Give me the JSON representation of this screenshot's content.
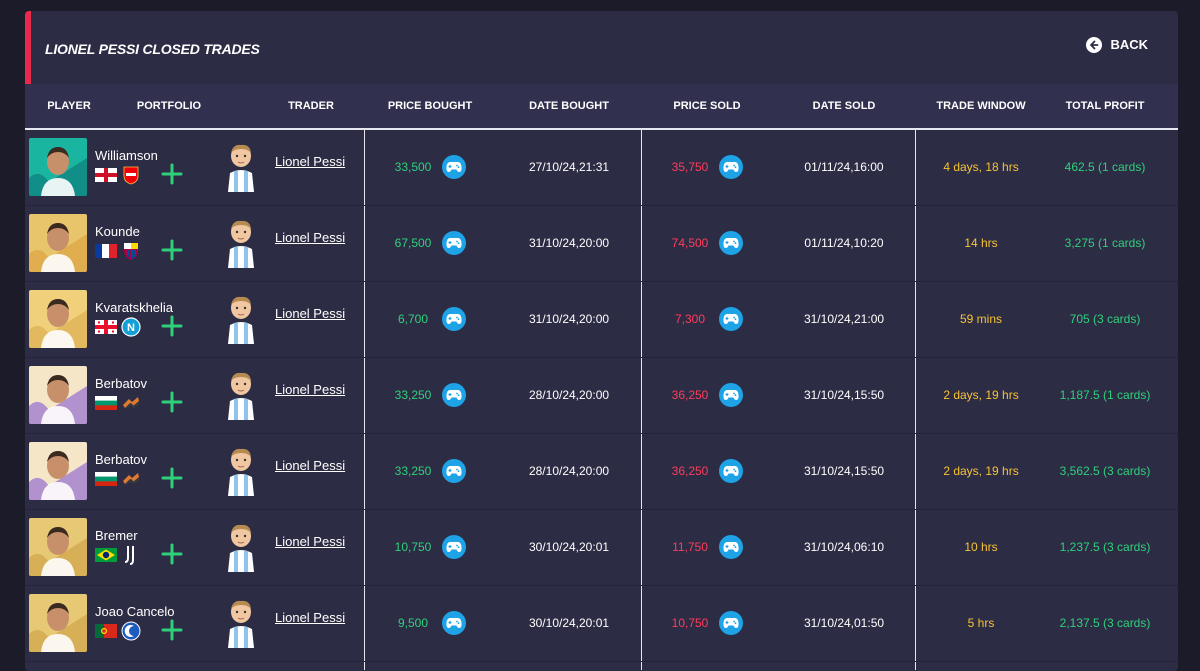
{
  "header": {
    "title": "LIONEL PESSI CLOSED TRADES",
    "back_label": "BACK"
  },
  "columns": [
    "PLAYER",
    "PORTFOLIO",
    "TRADER",
    "PRICE BOUGHT",
    "DATE BOUGHT",
    "PRICE SOLD",
    "DATE SOLD",
    "TRADE WINDOW",
    "TOTAL PROFIT"
  ],
  "rows": [
    {
      "player": "Williamson",
      "flag": "flag-england",
      "club": "arsenal-crest",
      "trader": "Lionel Pessi",
      "price_bought": "33,500",
      "date_bought": "27/10/24,21:31",
      "price_sold": "35,750",
      "date_sold": "01/11/24,16:00",
      "trade_window": "4 days, 18 hrs",
      "total_profit": "462.5 (1 cards)"
    },
    {
      "player": "Kounde",
      "flag": "flag-france",
      "club": "barcelona-crest",
      "trader": "Lionel Pessi",
      "price_bought": "67,500",
      "date_bought": "31/10/24,20:00",
      "price_sold": "74,500",
      "date_sold": "01/11/24,10:20",
      "trade_window": "14 hrs",
      "total_profit": "3,275 (1 cards)"
    },
    {
      "player": "Kvaratskhelia",
      "flag": "flag-georgia",
      "club": "napoli-crest",
      "trader": "Lionel Pessi",
      "price_bought": "6,700",
      "date_bought": "31/10/24,20:00",
      "price_sold": "7,300",
      "date_sold": "31/10/24,21:00",
      "trade_window": "59 mins",
      "total_profit": "705 (3 cards)"
    },
    {
      "player": "Berbatov",
      "flag": "flag-bulgaria",
      "club": "icons-crest",
      "trader": "Lionel Pessi",
      "price_bought": "33,250",
      "date_bought": "28/10/24,20:00",
      "price_sold": "36,250",
      "date_sold": "31/10/24,15:50",
      "trade_window": "2 days, 19 hrs",
      "total_profit": "1,187.5 (1 cards)"
    },
    {
      "player": "Berbatov",
      "flag": "flag-bulgaria",
      "club": "icons-crest",
      "trader": "Lionel Pessi",
      "price_bought": "33,250",
      "date_bought": "28/10/24,20:00",
      "price_sold": "36,250",
      "date_sold": "31/10/24,15:50",
      "trade_window": "2 days, 19 hrs",
      "total_profit": "3,562.5 (3 cards)"
    },
    {
      "player": "Bremer",
      "flag": "flag-brazil",
      "club": "juventus-crest",
      "trader": "Lionel Pessi",
      "price_bought": "10,750",
      "date_bought": "30/10/24,20:01",
      "price_sold": "11,750",
      "date_sold": "31/10/24,06:10",
      "trade_window": "10 hrs",
      "total_profit": "1,237.5 (3 cards)"
    },
    {
      "player": "Joao Cancelo",
      "flag": "flag-portugal",
      "club": "al-hilal-crest",
      "trader": "Lionel Pessi",
      "price_bought": "9,500",
      "date_bought": "30/10/24,20:01",
      "price_sold": "10,750",
      "date_sold": "31/10/24,01:50",
      "trade_window": "5 hrs",
      "total_profit": "2,137.5 (3 cards)"
    }
  ],
  "colors": {
    "page_bg": "#1c1b2a",
    "panel_bg": "#2d2c45",
    "accent_red": "#e8294c",
    "profit_green": "#2fd07b",
    "sold_red": "#ff3c5a",
    "window_yellow": "#f7c331",
    "platform_blue": "#1ea3e6"
  },
  "icons": {
    "back": "arrow-left-circle-icon",
    "add": "plus-icon",
    "platform": "gamepad-icon",
    "trader": "trader-avatar-icon"
  }
}
